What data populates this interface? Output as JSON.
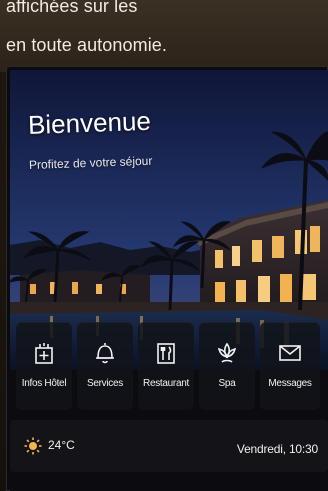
{
  "caption": {
    "line1": "affichées sur les",
    "line2": "en toute autonomie."
  },
  "screen": {
    "title": "Bienvenue",
    "subtitle": "Profitez de votre séjour"
  },
  "services": [
    {
      "label": "Infos Hôtel",
      "icon": "hotel-info-icon"
    },
    {
      "label": "Services",
      "icon": "bell-icon"
    },
    {
      "label": "Restaurant",
      "icon": "fork-knife-icon"
    },
    {
      "label": "Spa",
      "icon": "lotus-icon"
    },
    {
      "label": "Messages",
      "icon": "envelope-icon"
    }
  ],
  "status": {
    "weather_icon": "sun-icon",
    "temperature": "24°C",
    "datetime": "Vendredi, 10:30"
  },
  "colors": {
    "accent_sun": "#f2b54a",
    "tile_bg": "#12141a",
    "text": "#ffffff"
  }
}
